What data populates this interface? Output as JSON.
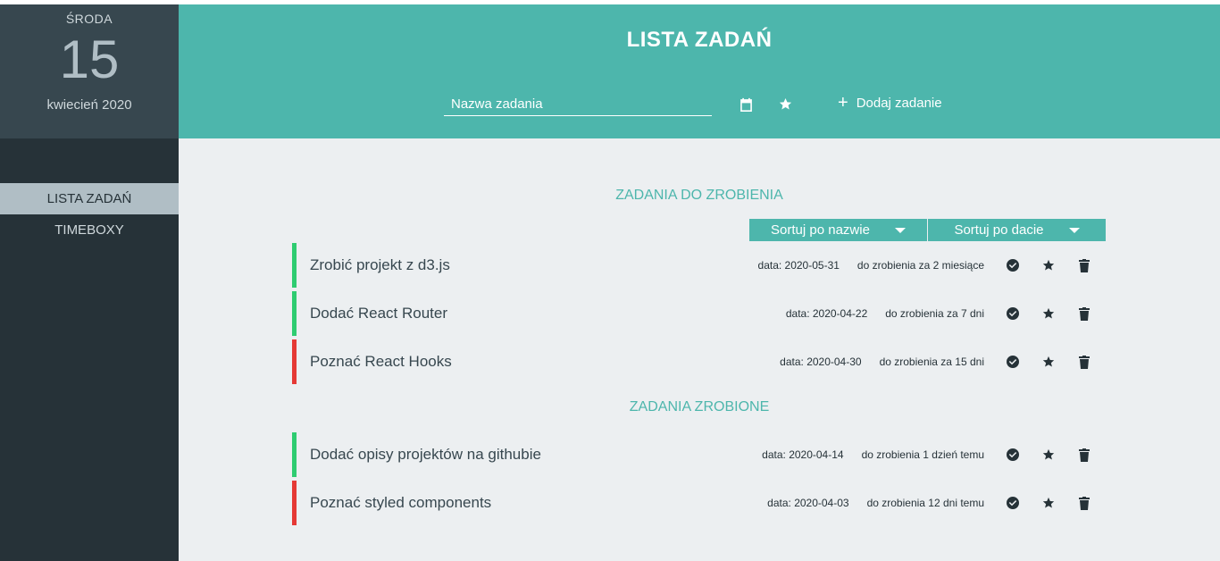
{
  "sidebar": {
    "weekday": "ŚRODA",
    "day": "15",
    "month_year": "kwiecień 2020",
    "nav": [
      {
        "label": "LISTA ZADAŃ",
        "active": true
      },
      {
        "label": "TIMEBOXY",
        "active": false
      }
    ]
  },
  "header": {
    "title": "LISTA ZADAŃ",
    "input_placeholder": "Nazwa zadania",
    "calendar_icon": "calendar-icon",
    "star_icon": "star-icon",
    "add_label": "Dodaj zadanie"
  },
  "todo": {
    "title": "ZADANIA DO ZROBIENIA",
    "sort_by_name": "Sortuj po nazwie",
    "sort_by_date": "Sortuj po dacie",
    "tasks": [
      {
        "name": "Zrobić projekt z d3.js",
        "date": "data: 2020-05-31",
        "due": "do zrobienia za 2 miesiące",
        "color": "#2ecc71"
      },
      {
        "name": "Dodać React Router",
        "date": "data: 2020-04-22",
        "due": "do zrobienia za 7 dni",
        "color": "#2ecc71"
      },
      {
        "name": "Poznać React Hooks",
        "date": "data: 2020-04-30",
        "due": "do zrobienia za 15 dni",
        "color": "#e53935"
      }
    ]
  },
  "done": {
    "title": "ZADANIA ZROBIONE",
    "tasks": [
      {
        "name": "Dodać opisy projektów na githubie",
        "date": "data: 2020-04-14",
        "due": "do zrobienia 1 dzień temu",
        "color": "#2ecc71"
      },
      {
        "name": "Poznać styled components",
        "date": "data: 2020-04-03",
        "due": "do zrobienia 12 dni temu",
        "color": "#e53935"
      }
    ]
  },
  "colors": {
    "accent": "#4db6ac",
    "sidebar": "#263238",
    "green": "#2ecc71",
    "red": "#e53935"
  }
}
